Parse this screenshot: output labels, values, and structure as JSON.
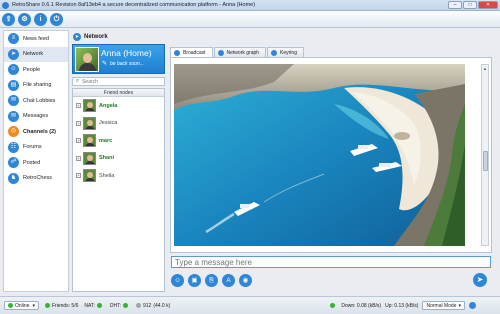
{
  "window": {
    "title": "RetroShare 0.6.1 Revision 8af13eb4 a secure decentralized communication platform - Anna (Home)",
    "buttons": {
      "minimize": "–",
      "maximize": "□",
      "close": "✕"
    }
  },
  "toolbar": {
    "icons": [
      "share-icon",
      "settings-icon",
      "info-icon",
      "power-icon"
    ],
    "glyphs": [
      "⇪",
      "⚙",
      "i",
      "⏻"
    ]
  },
  "sidebar": {
    "items": [
      {
        "label": "News feed",
        "icon": "news-feed-icon",
        "glyph": "≡"
      },
      {
        "label": "Network",
        "icon": "network-icon",
        "glyph": "➤"
      },
      {
        "label": "People",
        "icon": "people-icon",
        "glyph": "☺"
      },
      {
        "label": "File sharing",
        "icon": "file-sharing-icon",
        "glyph": "▤"
      },
      {
        "label": "Chat Lobbies",
        "icon": "chat-lobbies-icon",
        "glyph": "✉"
      },
      {
        "label": "Messages",
        "icon": "messages-icon",
        "glyph": "✉"
      },
      {
        "label": "Channels (2)",
        "icon": "channels-icon",
        "glyph": "◎"
      },
      {
        "label": "Forums",
        "icon": "forums-icon",
        "glyph": "☷"
      },
      {
        "label": "Posted",
        "icon": "posted-icon",
        "glyph": "☍"
      },
      {
        "label": "RetroChess",
        "icon": "retrochess-icon",
        "glyph": "♞"
      }
    ]
  },
  "network": {
    "header": "Network",
    "profile": {
      "name": "Anna (Home)",
      "status": "be back soon..."
    },
    "search_placeholder": "Search",
    "friends_header": "Friend nodes",
    "friends": [
      {
        "name": "Angela",
        "online": true
      },
      {
        "name": "Jessica",
        "online": false
      },
      {
        "name": "marc",
        "online": true
      },
      {
        "name": "Shani",
        "online": true
      },
      {
        "name": "Sheila",
        "online": false
      }
    ]
  },
  "tabs": [
    "Broadcast",
    "Network graph",
    "Keyring"
  ],
  "compose": {
    "placeholder": "Type a message here",
    "tools": [
      "smiley-icon",
      "picture-icon",
      "attach-icon",
      "font-icon",
      "image-icon"
    ],
    "tool_glyphs": [
      "☺",
      "▣",
      "⎘",
      "A",
      "◉"
    ],
    "send_glyph": "➤"
  },
  "status": {
    "online_label": "Online",
    "friends": "Friends: 5/6",
    "nat": "NAT:",
    "dht": "DHT:",
    "peers": "912",
    "peers_extra": "(44.0 k)",
    "down": "Down: 0.08 (kB/s)",
    "up": "Up: 0.13 (kB/s)",
    "mode": "Normal Mode"
  }
}
